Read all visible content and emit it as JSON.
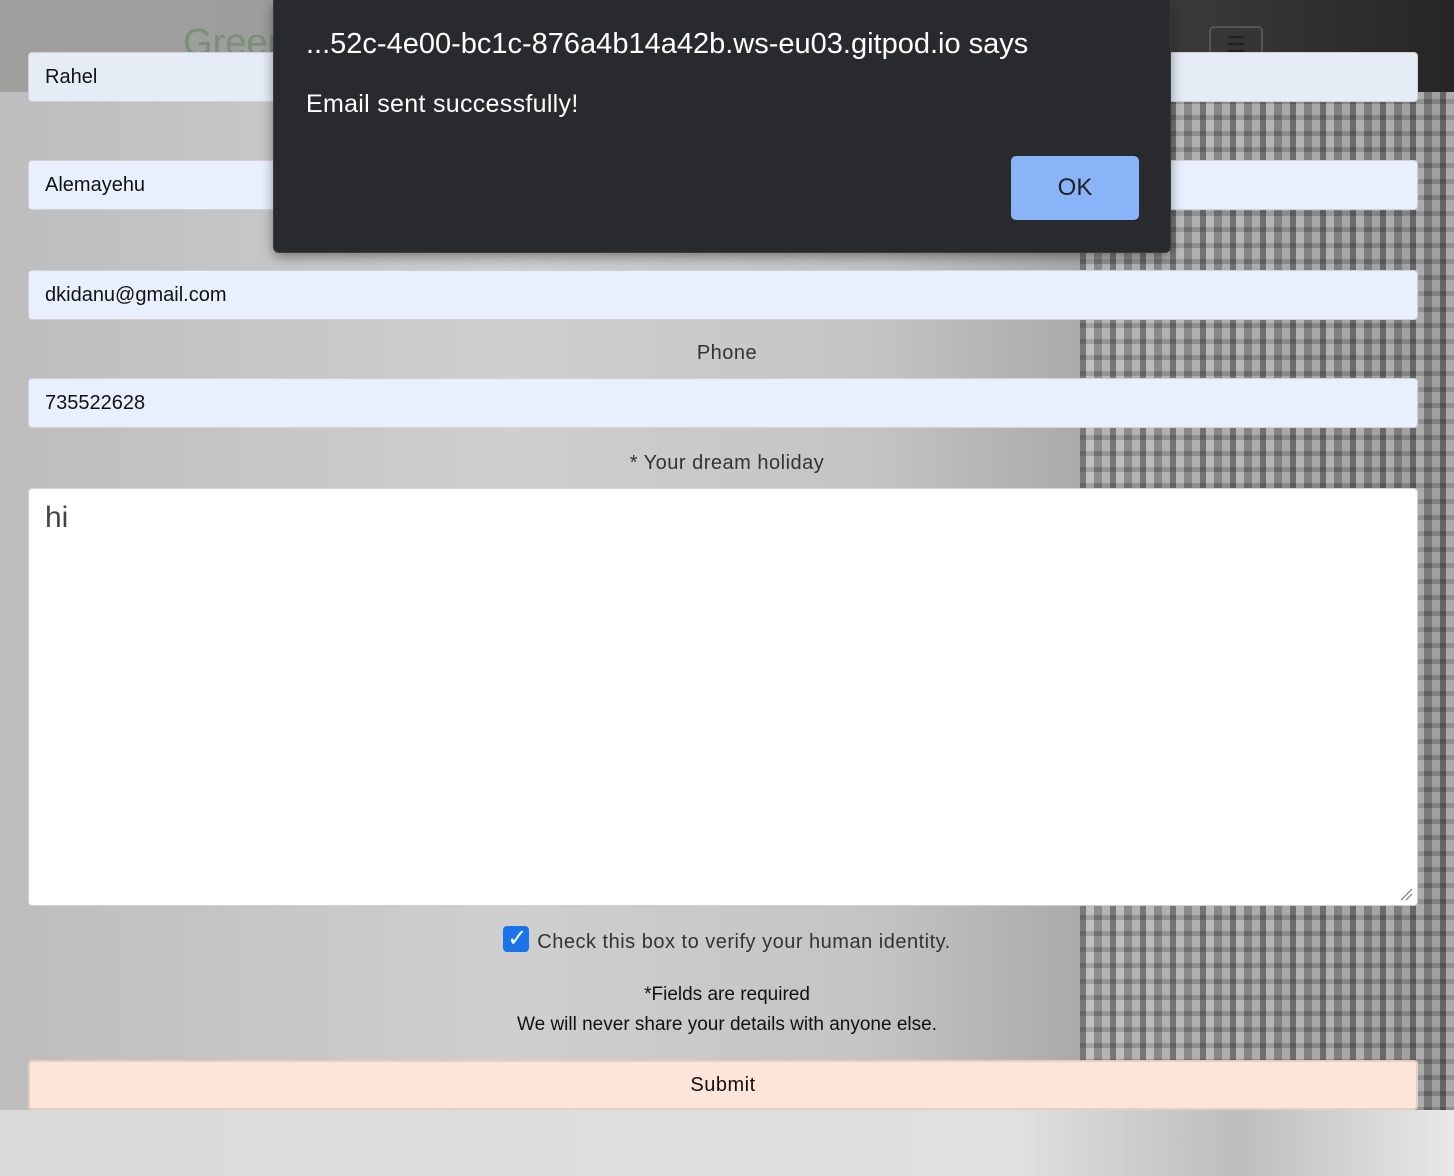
{
  "navbar": {
    "brand_partial": "Greer",
    "menu_icon": "hamburger-menu-icon"
  },
  "form": {
    "first_name_value": "Rahel",
    "last_name_value": "Alemayehu",
    "email_value": "dkidanu@gmail.com",
    "phone_label": "Phone",
    "phone_value": "735522628",
    "holiday_label": "* Your dream holiday",
    "holiday_value": "hi",
    "verify_checked": true,
    "verify_label": "Check this box to verify your human identity.",
    "required_note": "*Fields are required",
    "privacy_note": "We will never share your details with anyone else.",
    "submit_label": "Submit"
  },
  "alert": {
    "title": "...52c-4e00-bc1c-876a4b14a42b.ws-eu03.gitpod.io says",
    "message": "Email sent successfully!",
    "ok_label": "OK",
    "ok_color": "#8ab4f8",
    "background_color": "#292a2d"
  }
}
